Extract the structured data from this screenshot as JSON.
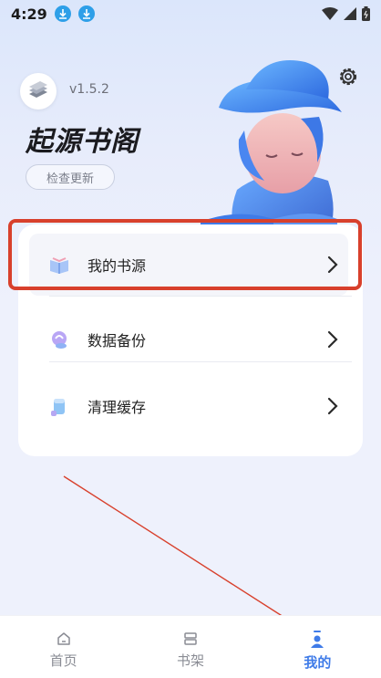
{
  "status_bar": {
    "time": "4:29",
    "icons": [
      "download-icon",
      "download-icon",
      "wifi-icon",
      "signal-icon",
      "battery-icon"
    ]
  },
  "app": {
    "version": "v1.5.2",
    "title": "起源书阁",
    "check_update_label": "检查更新"
  },
  "menu": {
    "items": [
      {
        "label": "我的书源",
        "icon": "book-source-icon",
        "highlighted": true
      },
      {
        "label": "数据备份",
        "icon": "backup-icon"
      },
      {
        "label": "清理缓存",
        "icon": "cache-icon"
      }
    ]
  },
  "tabs": [
    {
      "label": "首页",
      "icon": "home-icon"
    },
    {
      "label": "书架",
      "icon": "bookshelf-icon"
    },
    {
      "label": "我的",
      "icon": "user-icon",
      "active": true
    }
  ],
  "colors": {
    "accent": "#3f7be8",
    "highlight_box": "#d8402c",
    "download_icon": "#2e9fe8"
  }
}
